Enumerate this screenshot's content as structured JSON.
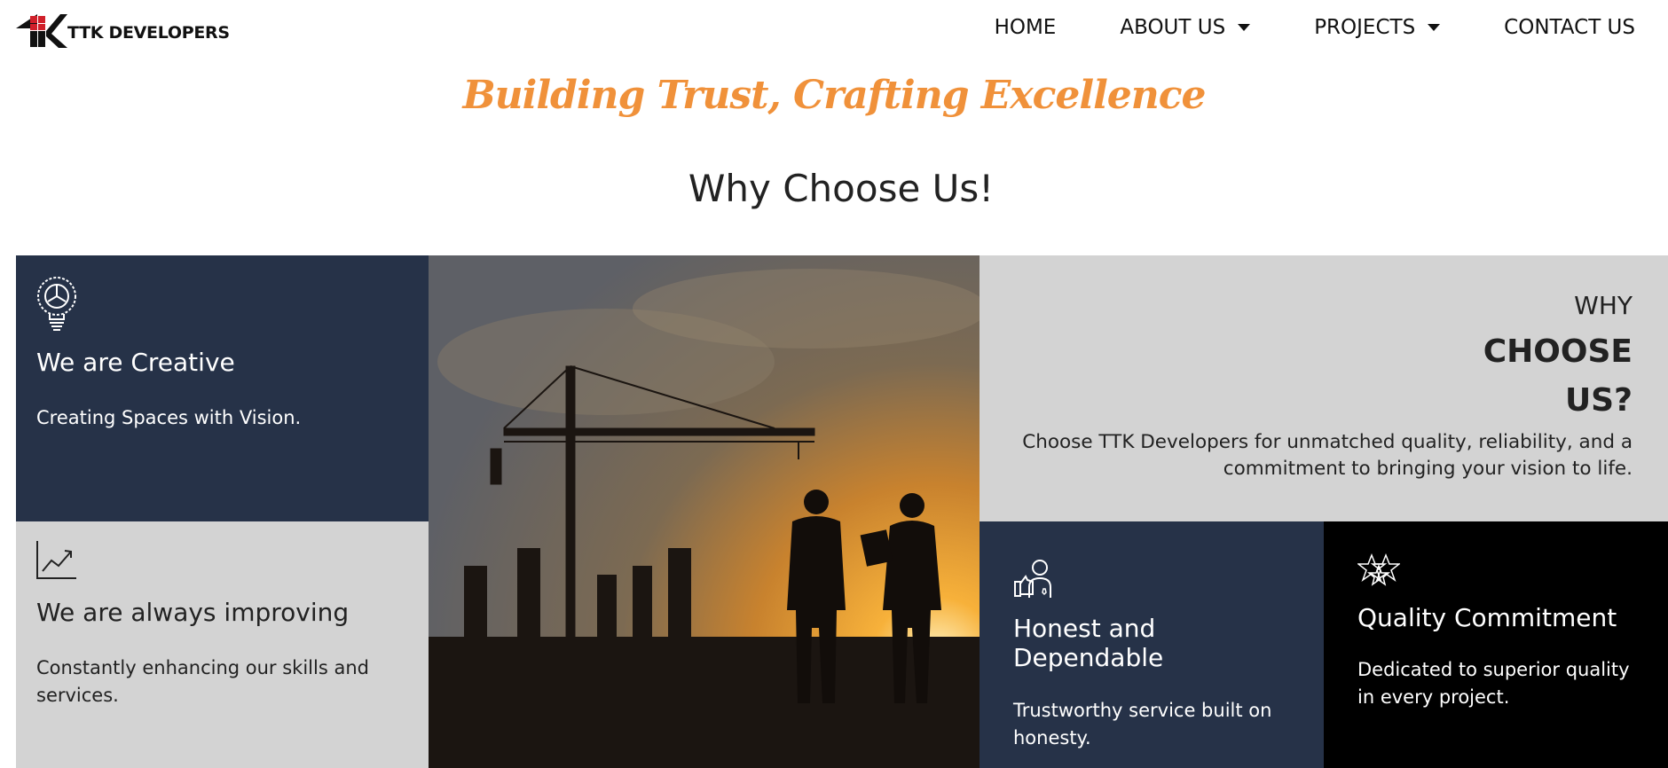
{
  "brand": {
    "name": "TTK DEVELOPERS",
    "logo_icon": "ttk-logo-icon",
    "logo_colors": [
      "#d0202a",
      "#111111"
    ]
  },
  "nav": {
    "home": "HOME",
    "about": "ABOUT US",
    "projects": "PROJECTS",
    "contact": "CONTACT US"
  },
  "tagline": "Building Trust, Crafting Excellence",
  "section_title": "Why Choose Us!",
  "cards": {
    "creative": {
      "icon": "lightbulb-icon",
      "title": "We are Creative",
      "text": "Creating Spaces with Vision."
    },
    "improving": {
      "icon": "growth-chart-icon",
      "title": "We are always improving",
      "text": "Constantly enhancing our skills and services."
    },
    "honest": {
      "icon": "handshake-person-icon",
      "title": "Honest and Dependable",
      "text": "Trustworthy service built on honesty."
    },
    "quality": {
      "icon": "stars-icon",
      "title": "Quality Commitment",
      "text": "Dedicated to superior quality in every project."
    }
  },
  "why": {
    "small": "WHY",
    "big_line1": "CHOOSE",
    "big_line2": "US?",
    "text": "Choose TTK Developers for unmatched quality, reliability, and a commitment to bringing your vision to life."
  },
  "colors": {
    "accent": "#f0913a",
    "navy": "#263248",
    "gray": "#d3d3d3",
    "black": "#000000"
  }
}
